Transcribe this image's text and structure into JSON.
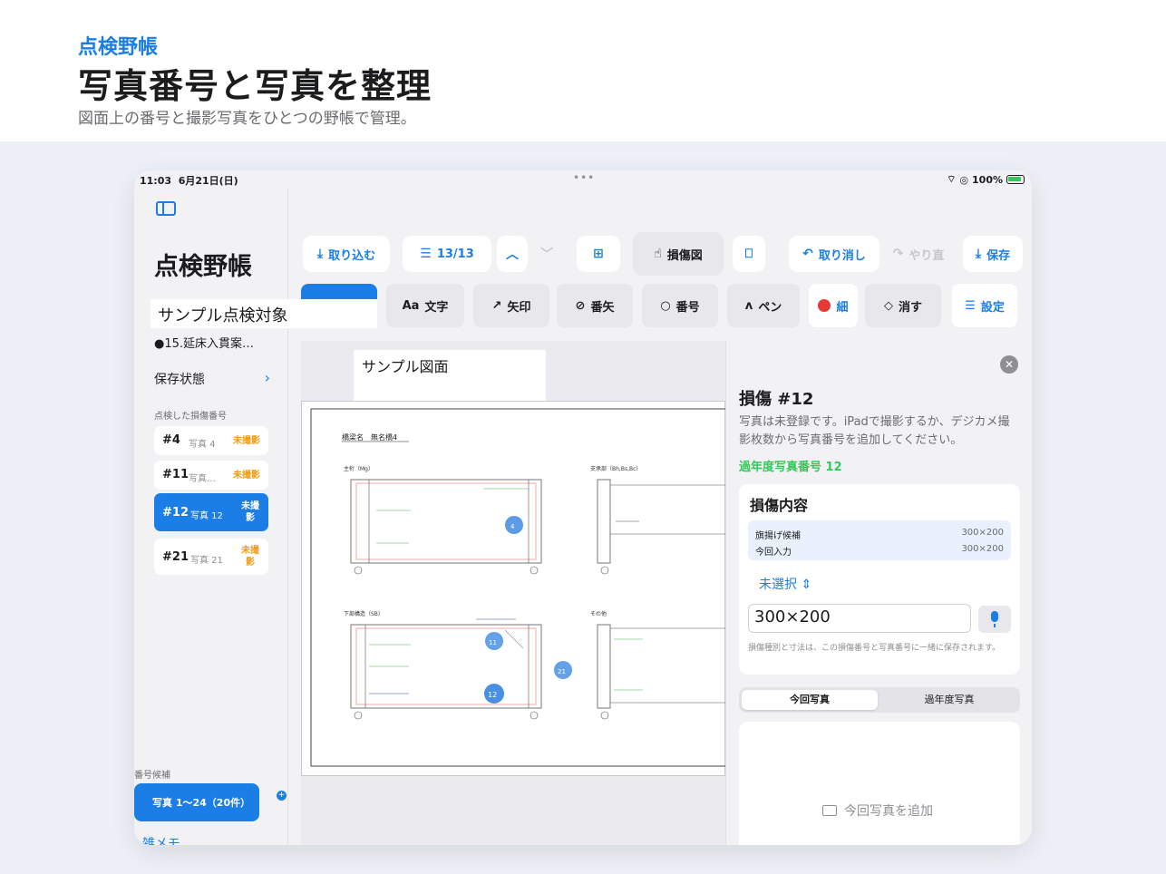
{
  "promo": {
    "eyebrow": "点検野帳",
    "headline": "写真番号と写真を整理",
    "sub": "図面上の番号と撮影写真をひとつの野帳で管理。"
  },
  "status": {
    "time": "11:03",
    "date": "6月21日(日)",
    "battery": "100%"
  },
  "sidebar": {
    "title": "点検野帳",
    "object_name": "サンプル点検対象",
    "object_sub": "●15.延床入貫案…",
    "save_state": "保存状態",
    "section_label": "点検した損傷番号",
    "damages": [
      {
        "num": "#4",
        "photo": "写真 4",
        "status": "未撮影"
      },
      {
        "num": "#11",
        "photo": "写真…",
        "status": "未撮影"
      },
      {
        "num": "#12",
        "photo": "写真 12",
        "status": "未撮影",
        "active": true
      },
      {
        "num": "#21",
        "photo": "写真 21",
        "status": "未撮影"
      }
    ],
    "candidates_label": "番号候補",
    "candidates_button": "写真 1〜24（20件）",
    "memo": "雑メモ"
  },
  "toolbar1": {
    "import": "取り込む",
    "pages": "13/13",
    "damage_map": "損傷図",
    "undo": "取り消し",
    "redo": "やり直",
    "save": "保存"
  },
  "toolbar2": {
    "text": "文字",
    "arrow": "矢印",
    "num_arrow": "番矢",
    "number": "番号",
    "pen": "ペン",
    "thin": "細",
    "erase": "消す",
    "settings": "設定"
  },
  "canvas": {
    "drawing_label": "サンプル図面",
    "sheet_title": "橋梁名　無名橋4",
    "sections": [
      "主桁（Mg）",
      "支承部（Bh,Bs,Bc）",
      "下部構造（SB）",
      "その他"
    ],
    "markers": [
      "4",
      "11",
      "12",
      "21"
    ]
  },
  "panel": {
    "title": "損傷 #12",
    "desc": "写真は未登録です。iPadで撮影するか、デジカメ撮影枚数から写真番号を追加してください。",
    "prev": "過年度写真番号 12",
    "card_title": "損傷内容",
    "rows": [
      {
        "label": "旗揚げ候補",
        "value": "300×200"
      },
      {
        "label": "今回入力",
        "value": "300×200"
      }
    ],
    "unselected": "未選択",
    "dimension_value": "300×200",
    "hint": "損傷種別と寸法は、この損傷番号と写真番号に一緒に保存されます。",
    "seg_current": "今回写真",
    "seg_past": "過年度写真",
    "add_photo": "今回写真を追加"
  }
}
